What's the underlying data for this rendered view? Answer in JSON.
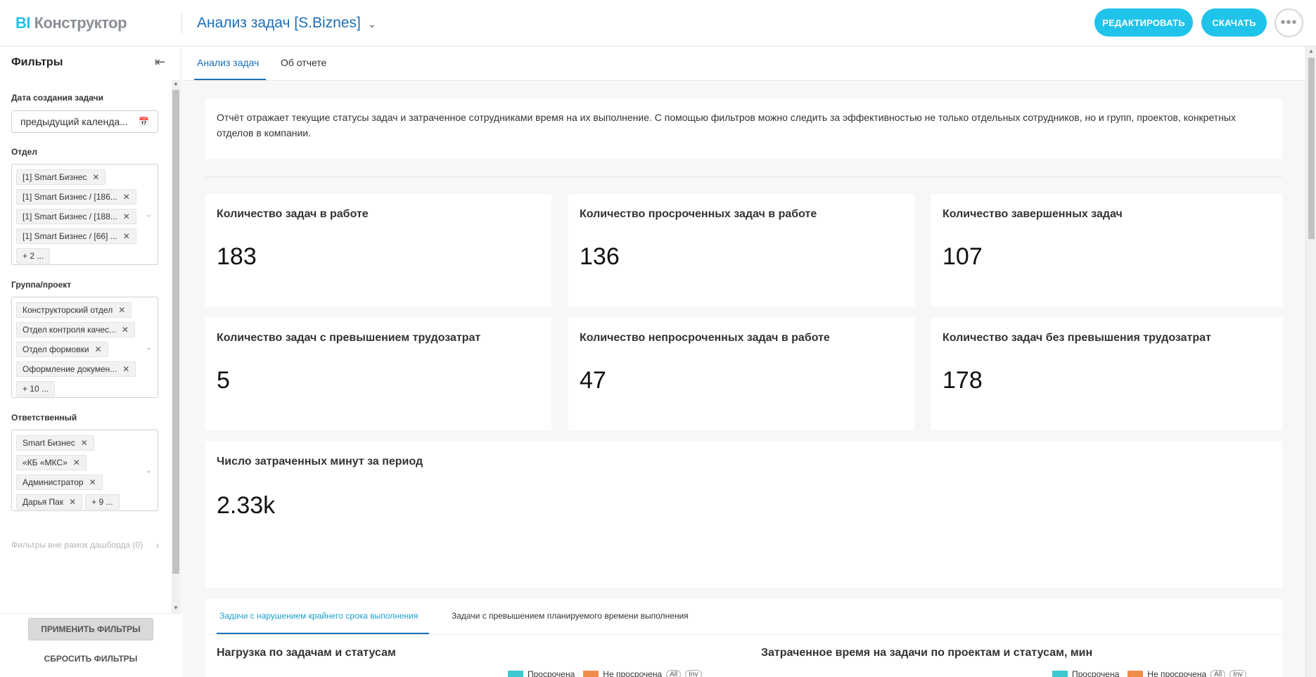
{
  "app": {
    "logo_bi": "BI",
    "logo_rest": "Конструктор"
  },
  "header": {
    "dashboard_title": "Анализ задач [S.Biznes]",
    "edit_label": "РЕДАКТИРОВАТЬ",
    "download_label": "СКАЧАТЬ"
  },
  "sidebar": {
    "title": "Фильтры",
    "date_filter": {
      "label": "Дата создания задачи",
      "value": "предыдущий календа..."
    },
    "department": {
      "label": "Отдел",
      "tags": [
        "[1] Smart Бизнес",
        "[1] Smart Бизнес / [186...",
        "[1] Smart Бизнес / [188...",
        "[1] Smart Бизнес / [66] ..."
      ],
      "more": "+ 2 ..."
    },
    "group": {
      "label": "Группа/проект",
      "tags": [
        "Конструкторский отдел",
        "Отдел контроля качес...",
        "Отдел формовки",
        "Оформление докумен..."
      ],
      "more": "+ 10 ..."
    },
    "responsible": {
      "label": "Ответственный",
      "tags": [
        "Smart Бизнес",
        "«КБ «МКС»",
        "Администратор",
        "Дарья Пак"
      ],
      "more": "+ 9 ..."
    },
    "outside_filters": "Фильтры вне рамок дашборда (0)",
    "apply_label": "ПРИМЕНИТЬ ФИЛЬТРЫ",
    "reset_label": "СБРОСИТЬ ФИЛЬТРЫ"
  },
  "tabs": [
    "Анализ задач",
    "Об отчете"
  ],
  "description": "Отчёт отражает текущие статусы задач и затраченное сотрудниками время на их выполнение. С помощью фильтров можно следить за эффективностью не только отдельных сотрудников, но и групп, проектов, конкретных отделов в компании.",
  "kpis": [
    {
      "title": "Количество задач в работе",
      "value": "183"
    },
    {
      "title": "Количество просроченных задач в работе",
      "value": "136"
    },
    {
      "title": "Количество завершенных задач",
      "value": "107"
    },
    {
      "title": "Количество задач с превышением трудозатрат",
      "value": "5"
    },
    {
      "title": "Количество непросроченных задач в работе",
      "value": "47"
    },
    {
      "title": "Количество задач без превышения трудозатрат",
      "value": "178"
    }
  ],
  "kpi_wide": {
    "title": "Число затраченных минут за период",
    "value": "2.33k"
  },
  "bottom": {
    "tabs": [
      "Задачи с нарушением крайнего срока выполнения",
      "Задачи с превышением планируемого времени выполнения"
    ],
    "chart_left_title": "Нагрузка по задачам и статусам",
    "chart_right_title": "Затраченное время на задачи по проектам и статусам, мин",
    "legend": [
      "Просрочена",
      "Не просрочена",
      "All",
      "Inv"
    ],
    "colors": {
      "overdue": "#3cc9d0",
      "not_overdue": "#f28c4b"
    }
  }
}
